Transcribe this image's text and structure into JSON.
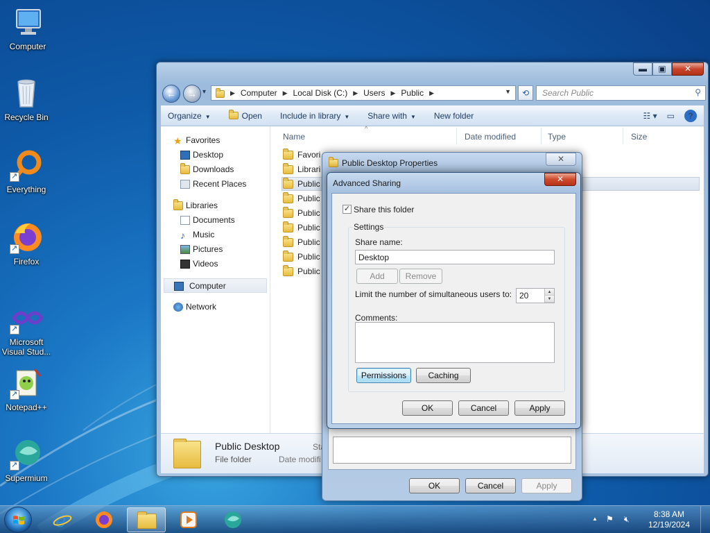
{
  "desktop": {
    "icons": [
      {
        "label": "Computer"
      },
      {
        "label": "Recycle Bin"
      },
      {
        "label": "Everything"
      },
      {
        "label": "Firefox"
      },
      {
        "label": "Microsoft Visual Stud..."
      },
      {
        "label": "Notepad++"
      },
      {
        "label": "Supermium"
      }
    ]
  },
  "explorer": {
    "caption": {
      "minimize": "▬",
      "maximize": "▣",
      "close": "✕"
    },
    "nav": {
      "back": "←",
      "forward": "→",
      "history": "▾"
    },
    "address": {
      "crumbs": [
        "Computer",
        "Local Disk (C:)",
        "Users",
        "Public"
      ],
      "separator": "▶"
    },
    "search": {
      "placeholder": "Search Public"
    },
    "toolbar": {
      "organize": "Organize",
      "open": "Open",
      "include_in_library": "Include in library",
      "share_with": "Share with",
      "new_folder": "New folder"
    },
    "navpane": {
      "favorites": "Favorites",
      "desktop": "Desktop",
      "downloads": "Downloads",
      "recent_places": "Recent Places",
      "libraries": "Libraries",
      "documents": "Documents",
      "music": "Music",
      "pictures": "Pictures",
      "videos": "Videos",
      "computer": "Computer",
      "network": "Network"
    },
    "columns": {
      "name": "Name",
      "date_modified": "Date modified",
      "type": "Type",
      "size": "Size"
    },
    "files": [
      "Favori",
      "Librari",
      "Public",
      "Public",
      "Public",
      "Public",
      "Public",
      "Public",
      "Public"
    ],
    "details": {
      "name": "Public Desktop",
      "type": "File folder",
      "label_state": "Sta",
      "label_date": "Date modifi"
    }
  },
  "properties_dialog": {
    "title": "Public Desktop Properties",
    "close": "✕",
    "ok": "OK",
    "cancel": "Cancel",
    "apply": "Apply"
  },
  "advanced_sharing": {
    "title": "Advanced Sharing",
    "close": "✕",
    "share_this_folder": {
      "label": "Share this folder",
      "checked": true
    },
    "settings_group": "Settings",
    "share_name_label": "Share name:",
    "share_name_value": "Desktop",
    "add": "Add",
    "remove": "Remove",
    "limit_label": "Limit the number of simultaneous users to:",
    "limit_value": "20",
    "comments_label": "Comments:",
    "comments_value": "",
    "permissions": "Permissions",
    "caching": "Caching",
    "ok": "OK",
    "cancel": "Cancel",
    "apply": "Apply"
  },
  "taskbar": {
    "apps": [
      "Internet Explorer",
      "Firefox",
      "Windows Explorer",
      "Media Player",
      "Supermium"
    ],
    "tray": {
      "show_hidden": "▲",
      "time": "8:38 AM",
      "date": "12/19/2024"
    }
  }
}
